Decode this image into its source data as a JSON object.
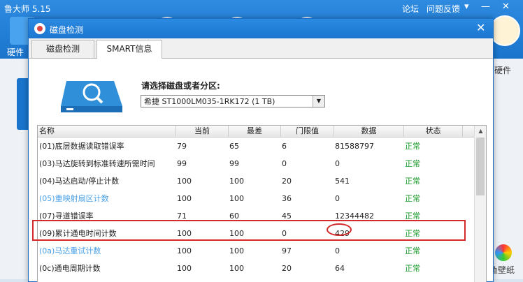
{
  "background_app": {
    "title": "鲁大师 5.15",
    "links": {
      "forum": "论坛",
      "feedback": "问题反馈"
    },
    "left_label": "硬件",
    "right_label": "硬件",
    "bottom_right_label": "鱼壁纸",
    "window_controls": [
      "▾",
      "—",
      "✕"
    ]
  },
  "dialog": {
    "title": "磁盘检测",
    "close": "✕",
    "tabs": [
      {
        "label": "磁盘检测",
        "active": false
      },
      {
        "label": "SMART信息",
        "active": true
      }
    ],
    "disk_select": {
      "label": "请选择磁盘或者分区:",
      "value": "希捷 ST1000LM035-1RK172 (1 TB)"
    },
    "table": {
      "headers": [
        "名称",
        "当前",
        "最差",
        "门限值",
        "数据",
        "状态"
      ],
      "rows": [
        {
          "name": "(01)底层数据读取错误率",
          "current": "79",
          "worst": "65",
          "threshold": "6",
          "data": "81588797",
          "status": "正常",
          "blue": false
        },
        {
          "name": "(03)马达旋转到标准转速所需时间",
          "current": "99",
          "worst": "99",
          "threshold": "0",
          "data": "0",
          "status": "正常",
          "blue": false
        },
        {
          "name": "(04)马达启动/停止计数",
          "current": "100",
          "worst": "100",
          "threshold": "20",
          "data": "541",
          "status": "正常",
          "blue": false
        },
        {
          "name": "(05)重映射扇区计数",
          "current": "100",
          "worst": "100",
          "threshold": "36",
          "data": "0",
          "status": "正常",
          "blue": true
        },
        {
          "name": "(07)寻道错误率",
          "current": "71",
          "worst": "60",
          "threshold": "45",
          "data": "12344482",
          "status": "正常",
          "blue": false
        },
        {
          "name": "(09)累计通电时间计数",
          "current": "100",
          "worst": "100",
          "threshold": "0",
          "data": "429",
          "status": "正常",
          "blue": false
        },
        {
          "name": "(0a)马达重试计数",
          "current": "100",
          "worst": "100",
          "threshold": "97",
          "data": "0",
          "status": "正常",
          "blue": true
        },
        {
          "name": "(0c)通电周期计数",
          "current": "100",
          "worst": "100",
          "threshold": "20",
          "data": "64",
          "status": "正常",
          "blue": false
        }
      ]
    }
  },
  "colors": {
    "titlebar": "#1b76d0",
    "status_ok": "#1a9a2a",
    "highlight": "#d42a2a",
    "blue_item": "#4aa0e6"
  }
}
